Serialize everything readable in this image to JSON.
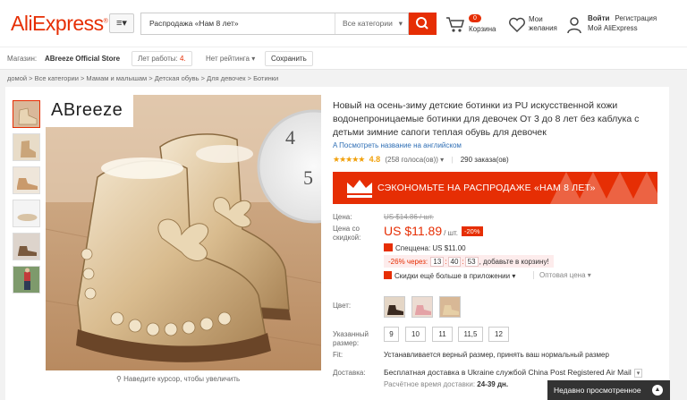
{
  "header": {
    "logo": "AliExpress",
    "logo_tm": "®",
    "menu_icon": "≡▾",
    "search_query": "Распродажа «Нам 8 лет»",
    "search_category": "Все категории",
    "cart_count": "0",
    "cart_label": "Корзина",
    "wish_label": "Мои желания",
    "login": "Войти",
    "register": "Регистрация",
    "my_aliexpress": "Мой AliExpress"
  },
  "storebar": {
    "store_label": "Магазин:",
    "store_name": "ABreeze Official Store",
    "years_label": "Лет работы:",
    "years_value": "4",
    "rating_label": "Нет рейтинга",
    "save_label": "Сохранить"
  },
  "breadcrumb": "домой  >  Все категории  >  Мамам и малышам  >  Детская обувь  >  Для девочек  >  Ботинки",
  "gallery": {
    "brand": "ABreeze",
    "zoom_hint": "Наведите курсор, чтобы увеличить"
  },
  "product": {
    "title": "Новый на осень-зиму детские ботинки из PU искусственной кожи водонепроницаемые ботинки для девочек От 3 до 8 лет без каблука с детьми зимние сапоги теплая обувь для девочек",
    "translate_link": "Посмотреть название на английском",
    "stars": "★★★★★",
    "rating": "4.8",
    "votes": "(258 голоса(ов))",
    "orders": "290 заказа(ов)",
    "sale_banner": "СЭКОНОМЬТЕ НА РАСПРОДАЖЕ «НАМ 8 ЛЕТ»",
    "price_label": "Цена:",
    "old_price": "US $14.86 / шт.",
    "sale_price_label": "Цена со скидкой:",
    "new_price": "US $11.89",
    "unit": "/ шт.",
    "discount": "-20%",
    "special_price": "Спеццена: US $11.00",
    "timer_prefix": "-26% через:",
    "timer_h": "13",
    "timer_m": "40",
    "timer_s": "53",
    "timer_suffix": ", добавьте в корзину!",
    "app_discount": "Скидки ещё больше в приложении",
    "wholesale": "Оптовая цена",
    "color_label": "Цвет:",
    "size_label": "Указанный размер:",
    "sizes": [
      "9",
      "10",
      "11",
      "11,5",
      "12"
    ],
    "fit_label": "Fit:",
    "fit_text": "Устанавливается верный размер, принять ваш нормальный размер",
    "delivery_label": "Доставка:",
    "delivery_text": "Бесплатная доставка в Ukraine службой China Post Registered Air Mail",
    "est_label": "Расчётное время доставки:",
    "est_value": "24-39 дн."
  },
  "recently_viewed": "Недавно просмотренное",
  "colors": {
    "accent": "#e62e04",
    "link": "#2f6fb5",
    "star": "#f1a00a"
  }
}
